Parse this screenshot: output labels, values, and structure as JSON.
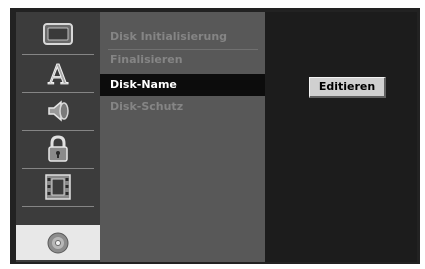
{
  "sidebar": {
    "categories": [
      {
        "icon": "tv-monitor-icon"
      },
      {
        "icon": "language-icon",
        "glyph": "A"
      },
      {
        "icon": "speaker-icon"
      },
      {
        "icon": "lock-icon"
      },
      {
        "icon": "film-strip-icon"
      },
      {
        "icon": "disc-icon",
        "selected": true
      }
    ]
  },
  "menu": {
    "items": [
      {
        "label": "Disk Initialisierung",
        "selected": false
      },
      {
        "label": "Finalisieren",
        "selected": false
      },
      {
        "label": "Disk-Name",
        "selected": true
      },
      {
        "label": "Disk-Schutz",
        "selected": false
      }
    ]
  },
  "action": {
    "button_label": "Editieren"
  },
  "colors": {
    "selection_bar": "#0c0c0c",
    "menu_background": "#585858",
    "sidebar_highlight": "#e8e8e8"
  }
}
